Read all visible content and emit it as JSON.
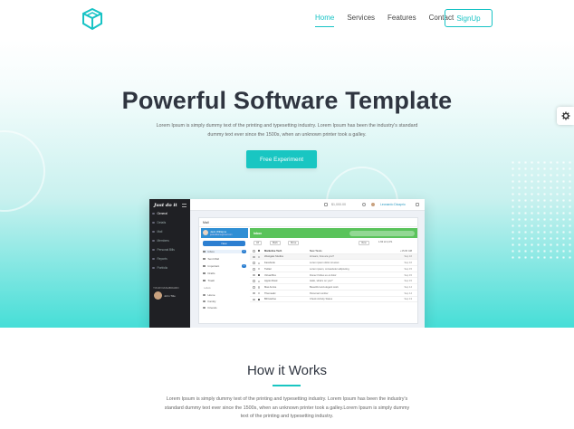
{
  "nav": {
    "links": [
      "Home",
      "Services",
      "Features",
      "Contact"
    ],
    "active": "Home",
    "signup_label": "SignUp"
  },
  "hero": {
    "title": "Powerful Software Template",
    "subtitle": "Lorem Ipsum is simply dummy text of the printing and typesetting industry. Lorem Ipsum has been the industry's standard dummy text ever since the 1500s, when an unknown printer took a galley.",
    "cta_label": "Free Experiment"
  },
  "mockup": {
    "brand": "Just do it",
    "sidebar_items": [
      "General",
      "Details",
      "Mail",
      "Members",
      "Personal Bills",
      "Reports",
      "Portfolio"
    ],
    "sidebar_section": "YOUR DASHBOARD",
    "sidebar_user": "John Title",
    "balance": "$1,000.00",
    "user_name": "Leonardo Dicaprio",
    "window_title": "Mail",
    "profile_name": "Jack Williams",
    "profile_email": "jackwilliams@mail.com",
    "new_label": "New",
    "folders": [
      {
        "label": "Inbox",
        "count": "3"
      },
      {
        "label": "Sent Mail",
        "count": ""
      },
      {
        "label": "Important",
        "count": "3"
      },
      {
        "label": "Drafts",
        "count": ""
      },
      {
        "label": "Trash",
        "count": ""
      }
    ],
    "labels_title": "Labels",
    "labels": [
      "Home",
      "Family",
      "Friends"
    ],
    "inbox_title": "Inbox",
    "toolbar": {
      "all": "All",
      "mark": "Mark",
      "move": "Move",
      "view": "View",
      "pages": "1-50 of 2,471"
    },
    "table_header": {
      "name": "Marketive Tech",
      "subject": "New Tasks",
      "date": "+15.00 AM"
    },
    "rows": [
      {
        "name": "Westgate Studios",
        "subject": "Hi team, how are you?",
        "date": "Sep 16"
      },
      {
        "name": "Facebook",
        "subject": "Lorem ipsum dolor sit amet",
        "date": "Sep 16"
      },
      {
        "name": "Twitter",
        "subject": "Lorem ipsum, consectetur adipiscing",
        "date": "Sep 15"
      },
      {
        "name": "Virtual Box",
        "subject": "Donec finibus ex et dolor",
        "date": "Sep 15"
      },
      {
        "name": "Apple Music",
        "subject": "Hello, what's on you?",
        "date": "Sep 15"
      },
      {
        "name": "Max Amine",
        "subject": "Beautiful and elegant work",
        "date": "Sep 14"
      },
      {
        "name": "Themeatic",
        "subject": "Personal number",
        "date": "Sep 14"
      },
      {
        "name": "Bill Harrise",
        "subject": "Check Activity Status",
        "date": "Sep 13"
      }
    ]
  },
  "how": {
    "title": "How it Works",
    "text": "Lorem Ipsum is simply dummy text of the printing and typesetting industry. Lorem Ipsum has been the industry's standard dummy text ever since the 1500s, when an unknown printer took a galley.Lorem Ipsum is simply dummy text of the printing and typesetting industry."
  },
  "colors": {
    "accent": "#19c6c2",
    "heading": "#2f3540",
    "inbox_green": "#5ac35b",
    "primary_blue": "#2c7fd1"
  },
  "icons": {
    "logo": "cube-logo-icon",
    "settings": "gear-icon"
  }
}
